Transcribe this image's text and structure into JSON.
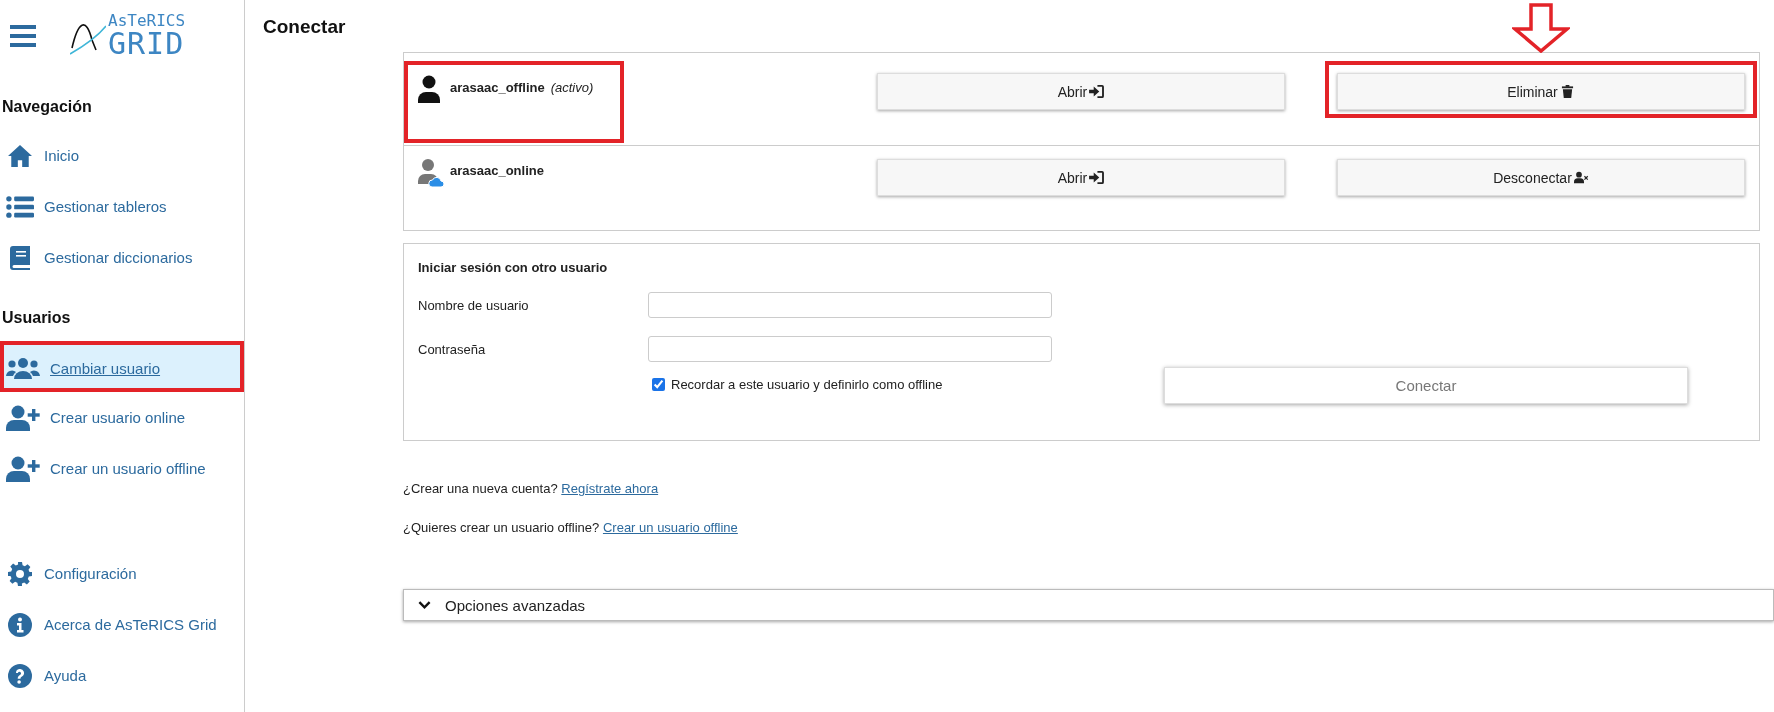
{
  "logo": {
    "line1": "AsTeRICS",
    "line2": "GRID"
  },
  "sidebar": {
    "sections": [
      {
        "heading": "Navegación",
        "items": [
          {
            "label": "Inicio",
            "kind": "home",
            "selected": false,
            "annotated": false
          },
          {
            "label": "Gestionar tableros",
            "kind": "list",
            "selected": false,
            "annotated": false
          },
          {
            "label": "Gestionar diccionarios",
            "kind": "book",
            "selected": false,
            "annotated": false
          }
        ]
      },
      {
        "heading": "Usuarios",
        "items": [
          {
            "label": "Cambiar usuario",
            "kind": "users",
            "selected": true,
            "annotated": true
          },
          {
            "label": "Crear usuario online",
            "kind": "user-plus",
            "selected": false,
            "annotated": false
          },
          {
            "label": "Crear un usuario offline",
            "kind": "user-plus",
            "selected": false,
            "annotated": false
          }
        ]
      },
      {
        "items": [
          {
            "label": "Configuración",
            "kind": "gear",
            "selected": false,
            "annotated": false
          },
          {
            "label": "Acerca de AsTeRICS Grid",
            "kind": "info",
            "selected": false,
            "annotated": false
          },
          {
            "label": "Ayuda",
            "kind": "question",
            "selected": false,
            "annotated": false
          }
        ]
      }
    ]
  },
  "page_title": "Conectar",
  "users": [
    {
      "name": "arasaac_offline",
      "status": "(activo)",
      "kind": "offline",
      "annotated": true,
      "buttons": [
        {
          "label": "Abrir",
          "kind": "sign-in",
          "annotated": false,
          "pointer_arrow": false
        },
        {
          "label": "Eliminar",
          "kind": "trash",
          "annotated": true,
          "pointer_arrow": true
        }
      ]
    },
    {
      "name": "arasaac_online",
      "kind": "online",
      "annotated": false,
      "buttons": [
        {
          "label": "Abrir",
          "kind": "sign-in",
          "annotated": false,
          "pointer_arrow": false
        },
        {
          "label": "Desconectar",
          "kind": "user-x",
          "annotated": false,
          "pointer_arrow": false
        }
      ]
    }
  ],
  "login": {
    "heading": "Iniciar sesión con otro usuario",
    "fields": [
      {
        "label": "Nombre de usuario"
      },
      {
        "label": "Contraseña"
      }
    ],
    "remember": {
      "label": "Recordar a este usuario y definirlo como offline",
      "checked": true
    },
    "submit": {
      "label": "Conectar",
      "disabled": true
    }
  },
  "links": [
    {
      "text": "¿Crear una nueva cuenta?",
      "link": "Regístrate ahora"
    },
    {
      "text": "¿Quieres crear un usuario offline?",
      "link": "Crear un usuario offline"
    }
  ],
  "advanced": {
    "label": "Opciones avanzadas",
    "expanded": false
  }
}
